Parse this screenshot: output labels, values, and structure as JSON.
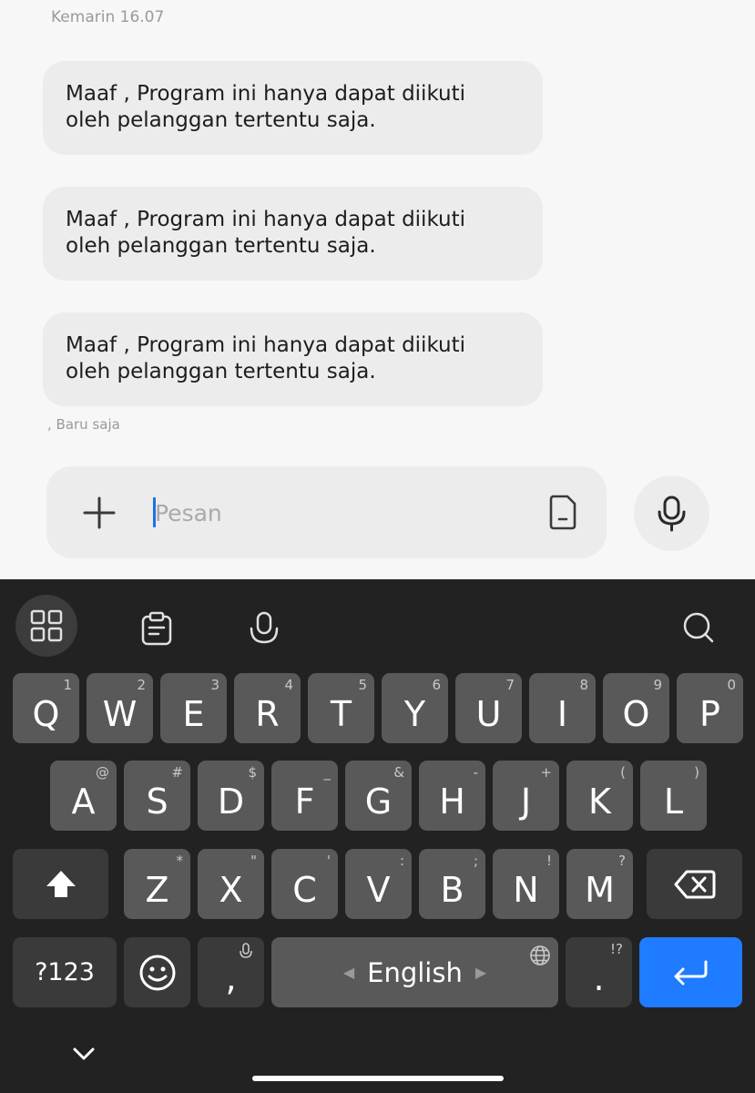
{
  "chat": {
    "timestamp": "Kemarin 16.07",
    "messages": [
      {
        "line1": "Maaf , Program ini hanya dapat diikuti",
        "line2": "oleh pelanggan tertentu saja."
      },
      {
        "line1": "Maaf , Program ini hanya dapat diikuti",
        "line2": "oleh pelanggan tertentu saja."
      },
      {
        "line1": "Maaf , Program ini hanya dapat diikuti",
        "line2": "oleh pelanggan tertentu saja."
      }
    ],
    "status": ", Baru saja"
  },
  "composer": {
    "placeholder": "Pesan",
    "value": "",
    "add_icon": "plus-icon",
    "sim_icon": "sim-card-icon",
    "voice_icon": "microphone-icon"
  },
  "keyboard": {
    "toolbar": [
      "apps-grid-icon",
      "clipboard-icon",
      "microphone-icon",
      "search-icon"
    ],
    "row1": [
      {
        "key": "Q",
        "hint": "1"
      },
      {
        "key": "W",
        "hint": "2"
      },
      {
        "key": "E",
        "hint": "3"
      },
      {
        "key": "R",
        "hint": "4"
      },
      {
        "key": "T",
        "hint": "5"
      },
      {
        "key": "Y",
        "hint": "6"
      },
      {
        "key": "U",
        "hint": "7"
      },
      {
        "key": "I",
        "hint": "8"
      },
      {
        "key": "O",
        "hint": "9"
      },
      {
        "key": "P",
        "hint": "0"
      }
    ],
    "row2": [
      {
        "key": "A",
        "hint": "@"
      },
      {
        "key": "S",
        "hint": "#"
      },
      {
        "key": "D",
        "hint": "$"
      },
      {
        "key": "F",
        "hint": "_"
      },
      {
        "key": "G",
        "hint": "&"
      },
      {
        "key": "H",
        "hint": "-"
      },
      {
        "key": "J",
        "hint": "+"
      },
      {
        "key": "K",
        "hint": "("
      },
      {
        "key": "L",
        "hint": ")"
      }
    ],
    "row3": [
      {
        "key": "Z",
        "hint": "*"
      },
      {
        "key": "X",
        "hint": "\""
      },
      {
        "key": "C",
        "hint": "'"
      },
      {
        "key": "V",
        "hint": ":"
      },
      {
        "key": "B",
        "hint": ";"
      },
      {
        "key": "N",
        "hint": "!"
      },
      {
        "key": "M",
        "hint": "?"
      }
    ],
    "symbols_label": "?123",
    "comma": ",",
    "space_label": "English",
    "period": ".",
    "period_hint": "!?",
    "colors": {
      "background": "#222222",
      "key": "#595959",
      "function_key": "#3a3a3a",
      "enter": "#1f7bff",
      "caret": "#1a73e8"
    }
  }
}
